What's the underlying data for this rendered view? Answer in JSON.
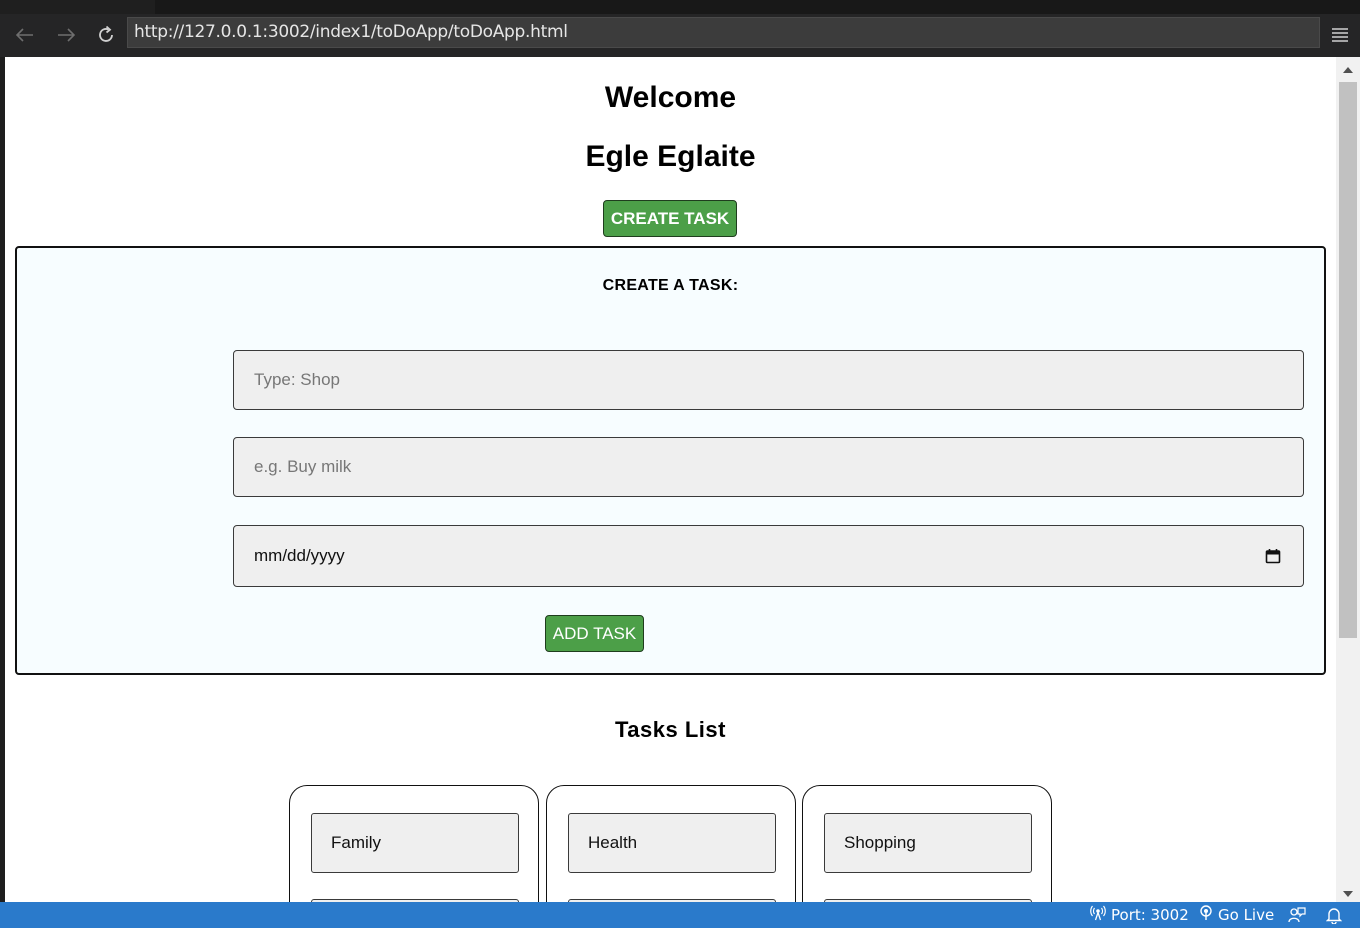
{
  "browser": {
    "url": "http://127.0.0.1:3002/index1/toDoApp/toDoApp.html",
    "icons": [
      "back-arrow-icon",
      "forward-arrow-icon",
      "reload-icon",
      "menu-icon"
    ]
  },
  "page": {
    "welcome": "Welcome",
    "user_name": "Egle Eglaite",
    "create_task_button": "CREATE TASK",
    "form": {
      "title": "CREATE A TASK:",
      "type_placeholder": "Type: Shop",
      "task_placeholder": "e.g. Buy milk",
      "date_placeholder": "mm/dd/yyyy",
      "add_task_button": "ADD TASK"
    },
    "tasks_title": "Tasks List",
    "categories": [
      {
        "label": "Family"
      },
      {
        "label": "Health"
      },
      {
        "label": "Shopping"
      }
    ]
  },
  "status_bar": {
    "port": "Port: 3002",
    "go_live": "Go Live"
  },
  "colors": {
    "accent_button": "#4c9f48",
    "status_bar": "#2a7acb",
    "form_background": "#f7fdff"
  }
}
